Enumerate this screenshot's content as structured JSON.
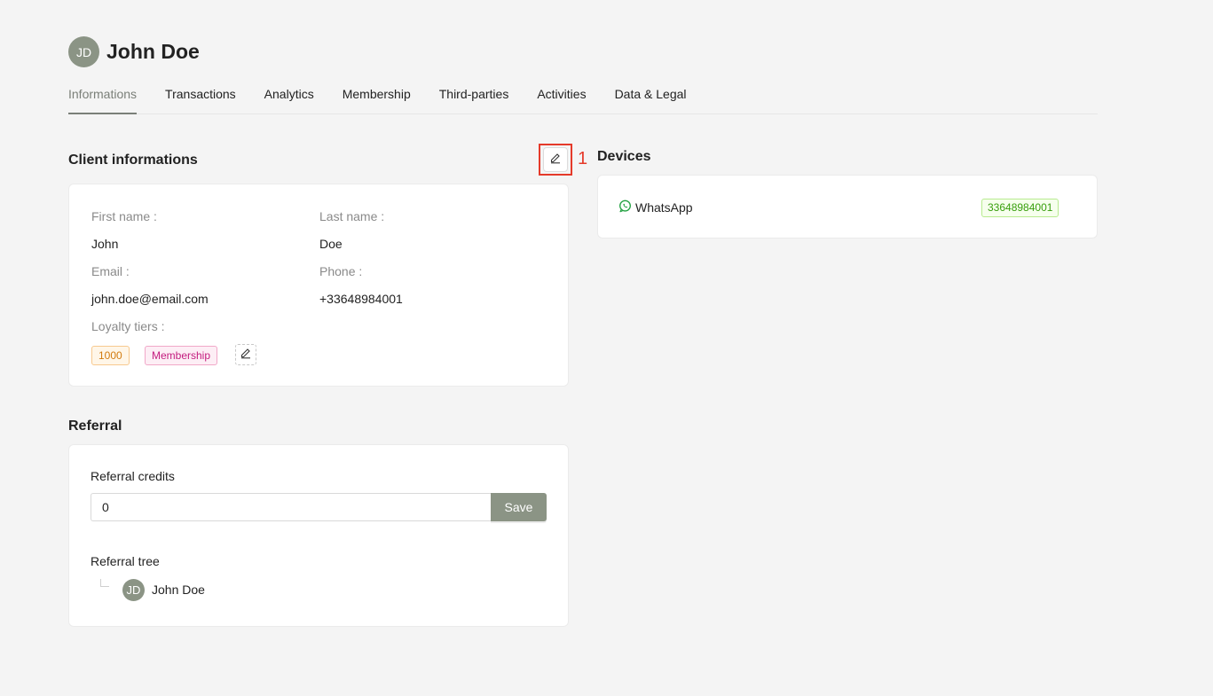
{
  "header": {
    "avatar_initials": "JD",
    "title": "John Doe"
  },
  "tabs": [
    {
      "label": "Informations",
      "active": true
    },
    {
      "label": "Transactions"
    },
    {
      "label": "Analytics"
    },
    {
      "label": "Membership"
    },
    {
      "label": "Third-parties"
    },
    {
      "label": "Activities"
    },
    {
      "label": "Data & Legal"
    }
  ],
  "client_info": {
    "title": "Client informations",
    "first_name_label": "First name :",
    "first_name": "John",
    "last_name_label": "Last name :",
    "last_name": "Doe",
    "email_label": "Email :",
    "email": "john.doe@email.com",
    "phone_label": "Phone :",
    "phone": "+33648984001",
    "loyalty_label": "Loyalty tiers :",
    "loyalty_tags": [
      "1000",
      "Membership"
    ]
  },
  "annotation": {
    "number": "1",
    "color": "#e53a2a"
  },
  "referral": {
    "title": "Referral",
    "credits_label": "Referral credits",
    "credits_value": "0",
    "save_label": "Save",
    "tree_label": "Referral tree",
    "tree_avatar": "JD",
    "tree_name": "John Doe"
  },
  "devices": {
    "title": "Devices",
    "items": [
      {
        "name": "WhatsApp",
        "number": "33648984001",
        "icon": "whatsapp-icon"
      }
    ]
  },
  "colors": {
    "accent": "#8b9485",
    "background": "#f4f4f4"
  }
}
